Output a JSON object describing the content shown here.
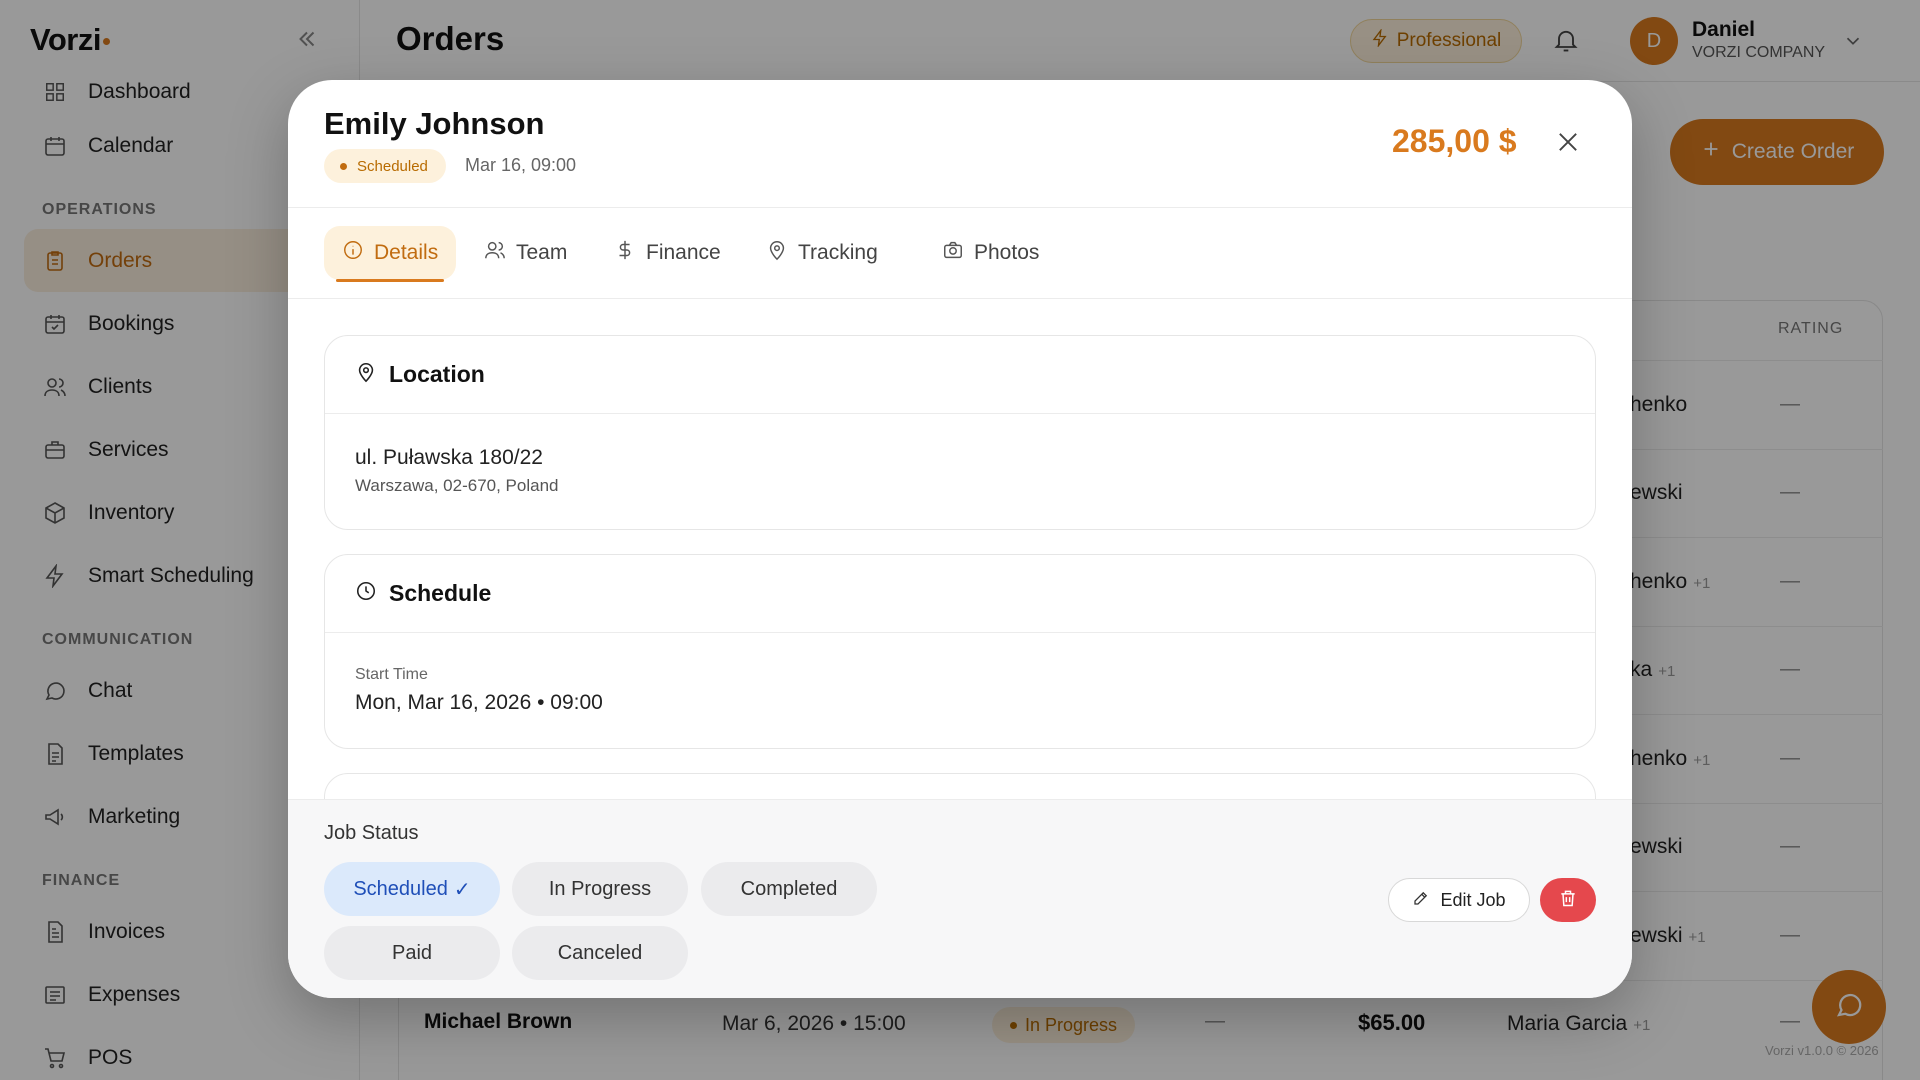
{
  "app": {
    "logo": "Vorzi",
    "page_title": "Orders"
  },
  "topbar": {
    "plan": "Professional",
    "user": {
      "initial": "D",
      "name": "Daniel",
      "company": "VORZI COMPANY"
    }
  },
  "sidebar": {
    "items": [
      {
        "label": "Dashboard",
        "icon": "grid-icon"
      },
      {
        "label": "Calendar",
        "icon": "calendar-icon"
      }
    ],
    "sections": [
      {
        "title": "OPERATIONS",
        "items": [
          {
            "label": "Orders",
            "icon": "clipboard-icon",
            "active": true
          },
          {
            "label": "Bookings",
            "icon": "calendar-check-icon"
          },
          {
            "label": "Clients",
            "icon": "users-icon"
          },
          {
            "label": "Services",
            "icon": "briefcase-icon"
          },
          {
            "label": "Inventory",
            "icon": "box-icon"
          },
          {
            "label": "Smart Scheduling",
            "icon": "lightning-icon"
          }
        ]
      },
      {
        "title": "COMMUNICATION",
        "items": [
          {
            "label": "Chat",
            "icon": "chat-icon"
          },
          {
            "label": "Templates",
            "icon": "document-icon"
          },
          {
            "label": "Marketing",
            "icon": "megaphone-icon"
          }
        ]
      },
      {
        "title": "FINANCE",
        "items": [
          {
            "label": "Invoices",
            "icon": "invoice-icon"
          },
          {
            "label": "Expenses",
            "icon": "receipt-icon"
          },
          {
            "label": "POS",
            "icon": "cart-icon"
          }
        ]
      }
    ]
  },
  "main": {
    "create_order": "Create Order",
    "rating_header": "RATING",
    "rows_partial": [
      {
        "assignee": "henko",
        "extra": ""
      },
      {
        "assignee": "ewski",
        "extra": ""
      },
      {
        "assignee": "henko",
        "extra": "+1"
      },
      {
        "assignee": "ka",
        "extra": "+1"
      },
      {
        "assignee": "henko",
        "extra": "+1"
      },
      {
        "assignee": "ewski",
        "extra": ""
      },
      {
        "assignee": "ewski",
        "extra": "+1"
      }
    ],
    "dash": "—",
    "last_row": {
      "name": "Michael Brown",
      "date": "Mar 6, 2026 • 15:00",
      "status": "In Progress",
      "dash": "—",
      "amount": "$65.00",
      "assignee": "Maria Garcia",
      "extra": "+1",
      "rating": "—"
    },
    "version": "Vorzi v1.0.0 © 2026"
  },
  "modal": {
    "client_name": "Emily Johnson",
    "status": "Scheduled",
    "date": "Mar 16, 09:00",
    "amount": "285,00 $",
    "tabs": [
      {
        "label": "Details",
        "icon": "info-icon",
        "active": true
      },
      {
        "label": "Team",
        "icon": "users-icon"
      },
      {
        "label": "Finance",
        "icon": "dollar-icon"
      },
      {
        "label": "Tracking",
        "icon": "pin-icon"
      },
      {
        "label": "Photos",
        "icon": "camera-icon"
      }
    ],
    "location": {
      "title": "Location",
      "line1": "ul. Puławska 180/22",
      "line2": "Warszawa, 02-670, Poland"
    },
    "schedule": {
      "title": "Schedule",
      "start_label": "Start Time",
      "start_value": "Mon, Mar 16, 2026 • 09:00"
    },
    "job_status": {
      "label": "Job Status",
      "options": [
        {
          "label": "Scheduled",
          "selected": true
        },
        {
          "label": "In Progress"
        },
        {
          "label": "Completed"
        },
        {
          "label": "Paid"
        },
        {
          "label": "Canceled"
        }
      ],
      "selected_mark": "✓"
    },
    "edit_label": "Edit Job"
  },
  "colors": {
    "accent": "#d97a1e",
    "danger": "#e5484d",
    "selected_blue": "#1f4fb8"
  }
}
